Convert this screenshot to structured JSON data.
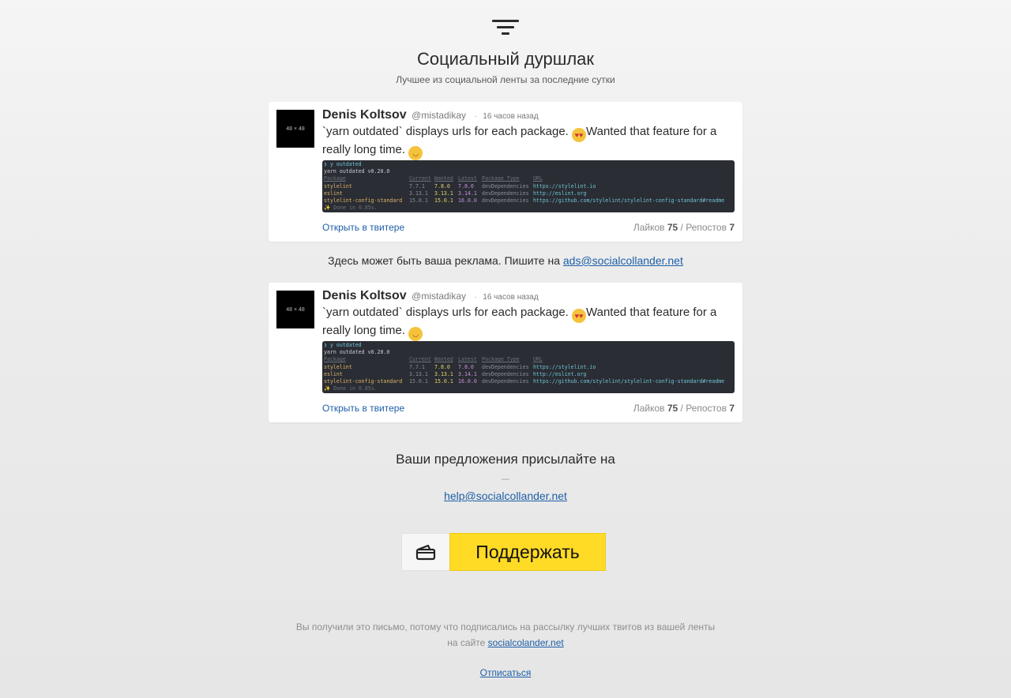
{
  "header": {
    "title": "Социальный дуршлак",
    "subtitle": "Лучшее из социальной ленты за последние сутки"
  },
  "tweets": [
    {
      "avatar_label": "48 × 48",
      "name": "Denis Koltsov",
      "handle": "@mistadikay",
      "separator": "·",
      "time": "16 часов назад",
      "text_part1": "`yarn outdated` displays urls for each package.",
      "text_part2": "Wanted that feature for a really long time.",
      "link": "Открыть в твитере",
      "likes_label": "Лайков",
      "likes": "75",
      "stats_sep": "/",
      "reposts_label": "Репостов",
      "reposts": "7"
    },
    {
      "avatar_label": "48 × 48",
      "name": "Denis Koltsov",
      "handle": "@mistadikay",
      "separator": "·",
      "time": "16 часов назад",
      "text_part1": "`yarn outdated` displays urls for each package.",
      "text_part2": "Wanted that feature for a really long time.",
      "link": "Открыть в твитере",
      "likes_label": "Лайков",
      "likes": "75",
      "stats_sep": "/",
      "reposts_label": "Репостов",
      "reposts": "7"
    }
  ],
  "terminal": {
    "prompt": "❯ y outdated",
    "version": "yarn outdated v0.20.0",
    "headers": [
      "Package",
      "Current",
      "Wanted",
      "Latest",
      "Package Type",
      "URL"
    ],
    "rows": [
      [
        "stylelint",
        "7.7.1",
        "7.8.0",
        "7.8.0",
        "devDependencies",
        "https://stylelint.io"
      ],
      [
        "eslint",
        "3.13.1",
        "3.13.1",
        "3.14.1",
        "devDependencies",
        "http://eslint.org"
      ],
      [
        "stylelint-config-standard",
        "15.0.1",
        "15.0.1",
        "16.0.0",
        "devDependencies",
        "https://github.com/stylelint/stylelint-config-standard#readme"
      ]
    ],
    "done": "✨ Done in 0.85s."
  },
  "ad": {
    "text": "Здесь может быть ваша реклама. Пишите на",
    "email": "ads@socialcollander.net"
  },
  "suggest": {
    "text": "Ваши предложения присылайте на",
    "email": "help@socialcollander.net"
  },
  "donate": {
    "label": "Поддержать",
    "icon": "wallet-icon"
  },
  "footer": {
    "text": "Вы получили это письмо, потому что подписались на рассылку лучших твитов из вашей ленты на сайте",
    "site": "socialcolander.net",
    "unsubscribe": "Отписаться"
  },
  "colors": {
    "link": "#1d5fa8",
    "donate": "#ffdb26",
    "terminal_bg": "#2a2d33"
  }
}
